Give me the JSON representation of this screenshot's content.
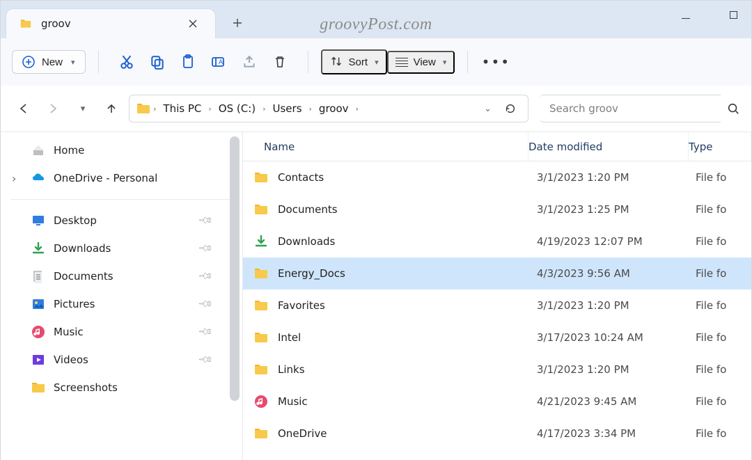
{
  "tab": {
    "title": "groov"
  },
  "watermark": "groovyPost.com",
  "toolbar": {
    "new_label": "New",
    "sort_label": "Sort",
    "view_label": "View"
  },
  "breadcrumb": [
    "This PC",
    "OS (C:)",
    "Users",
    "groov"
  ],
  "search": {
    "placeholder": "Search groov"
  },
  "columns": {
    "name": "Name",
    "date": "Date modified",
    "type": "Type"
  },
  "sidebar": {
    "top": [
      {
        "label": "Home",
        "icon": "home"
      },
      {
        "label": "OneDrive - Personal",
        "icon": "onedrive",
        "expandable": true
      }
    ],
    "quick": [
      {
        "label": "Desktop",
        "icon": "desktop",
        "pinned": true
      },
      {
        "label": "Downloads",
        "icon": "downloads",
        "pinned": true
      },
      {
        "label": "Documents",
        "icon": "documents",
        "pinned": true
      },
      {
        "label": "Pictures",
        "icon": "pictures",
        "pinned": true
      },
      {
        "label": "Music",
        "icon": "music",
        "pinned": true
      },
      {
        "label": "Videos",
        "icon": "videos",
        "pinned": true
      },
      {
        "label": "Screenshots",
        "icon": "folder",
        "pinned": false
      }
    ]
  },
  "rows": [
    {
      "name": "Contacts",
      "date": "3/1/2023 1:20 PM",
      "type": "File fo",
      "icon": "folder"
    },
    {
      "name": "Documents",
      "date": "3/1/2023 1:25 PM",
      "type": "File fo",
      "icon": "folder"
    },
    {
      "name": "Downloads",
      "date": "4/19/2023 12:07 PM",
      "type": "File fo",
      "icon": "downloads"
    },
    {
      "name": "Energy_Docs",
      "date": "4/3/2023 9:56 AM",
      "type": "File fo",
      "icon": "folder",
      "selected": true
    },
    {
      "name": "Favorites",
      "date": "3/1/2023 1:20 PM",
      "type": "File fo",
      "icon": "folder"
    },
    {
      "name": "Intel",
      "date": "3/17/2023 10:24 AM",
      "type": "File fo",
      "icon": "folder"
    },
    {
      "name": "Links",
      "date": "3/1/2023 1:20 PM",
      "type": "File fo",
      "icon": "folder"
    },
    {
      "name": "Music",
      "date": "4/21/2023 9:45 AM",
      "type": "File fo",
      "icon": "music"
    },
    {
      "name": "OneDrive",
      "date": "4/17/2023 3:34 PM",
      "type": "File fo",
      "icon": "folder"
    }
  ]
}
